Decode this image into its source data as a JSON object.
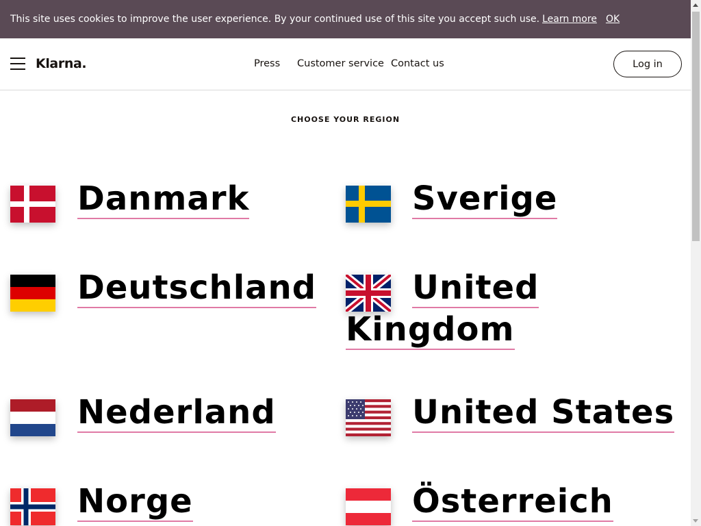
{
  "cookie_banner": {
    "text": "This site uses cookies to improve the user experience. By your continued use of this site you accept such use.",
    "learn_more": "Learn more",
    "ok": "OK"
  },
  "header": {
    "logo": "Klarna",
    "logo_dot": ".",
    "nav": [
      "Press",
      "Customer service",
      "Contact us"
    ],
    "login": "Log in"
  },
  "heading": "CHOOSE YOUR REGION",
  "regions": [
    {
      "name": "Danmark"
    },
    {
      "name": "Sverige"
    },
    {
      "name": "Deutschland"
    },
    {
      "name": "United Kingdom",
      "line1": "United",
      "line2": "Kingdom"
    },
    {
      "name": "Nederland"
    },
    {
      "name": "United States"
    },
    {
      "name": "Norge"
    },
    {
      "name": "Österreich"
    }
  ],
  "colors": {
    "cookie_bg": "#5a4a55",
    "link_underline": "#e07aa5",
    "text": "#17120f"
  }
}
